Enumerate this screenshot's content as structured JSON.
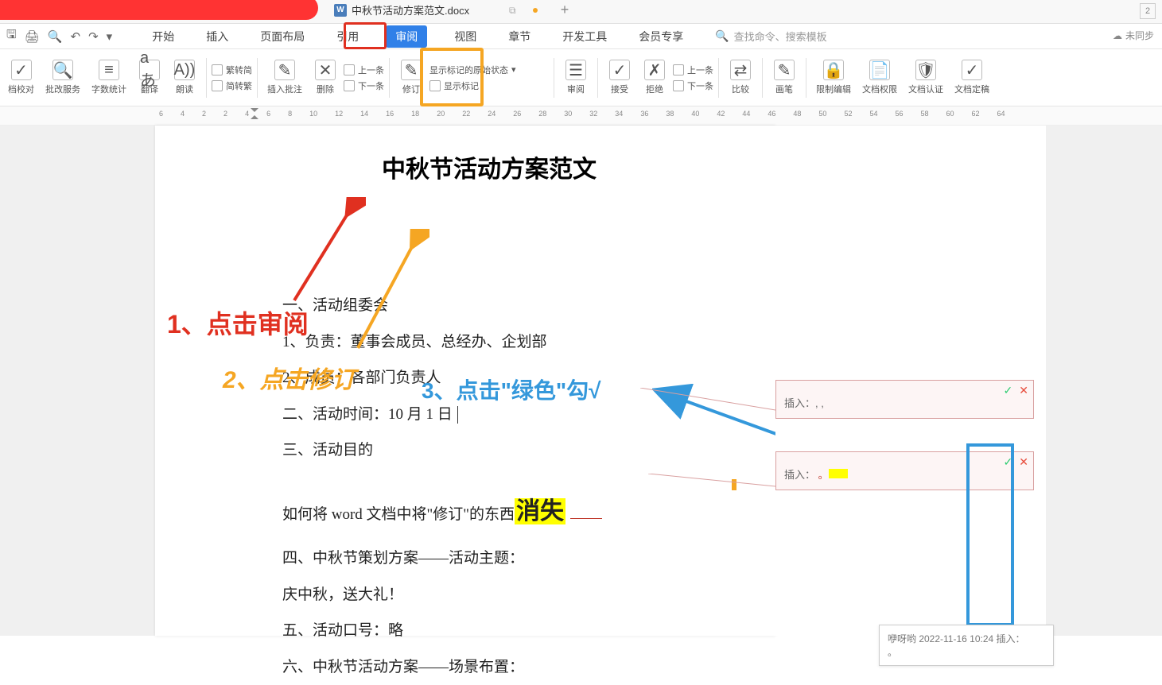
{
  "title_bar": {
    "file_name": "中秋节活动方案范文.docx",
    "file_badge": "W",
    "plus": "+",
    "right_badge": "2"
  },
  "menu": {
    "tabs": [
      "开始",
      "插入",
      "页面布局",
      "引用",
      "审阅",
      "视图",
      "章节",
      "开发工具",
      "会员专享"
    ],
    "active_index": 4,
    "search_placeholder": "查找命令、搜索模板",
    "sync": "未同步"
  },
  "ribbon": {
    "档校对": "档校对",
    "批改服务": "批改服务",
    "字数统计": "字数统计",
    "翻译": "翻译",
    "朗读": "朗读",
    "繁转简": "繁转简",
    "简转繁": "简转繁",
    "插入批注": "插入批注",
    "删除": "删除",
    "上一条": "上一条",
    "下一条": "下一条",
    "修订": "修订",
    "显示标记的原始状态": "显示标记的原始状态",
    "显示标记": "显示标记",
    "审阅": "审阅",
    "接受": "接受",
    "拒绝": "拒绝",
    "r上一条": "上一条",
    "r下一条": "下一条",
    "比较": "比较",
    "画笔": "画笔",
    "限制编辑": "限制编辑",
    "文档权限": "文档权限",
    "文档认证": "文档认证",
    "文档定稿": "文档定稿"
  },
  "annotations": {
    "step1": "1、点击审阅",
    "step2": "2、点击修订",
    "step3": "3、点击\"绿色\"勾√"
  },
  "document": {
    "title": "中秋节活动方案范文",
    "p1": "一、活动组委会",
    "p2": "1、负责：董事会成员、总经办、企划部",
    "p3": "2、成员：各部门负责人",
    "p4": "二、活动时间：10 月 1 日",
    "p5": "三、活动目的",
    "p6a": "如何将 word 文档中将\"修订\"的东西",
    "p6b": "消失",
    "p7": "四、中秋节策划方案——活动主题：",
    "p8": "庆中秋，送大礼！",
    "p9": "五、活动口号：略",
    "p10": "六、中秋节活动方案——场景布置："
  },
  "comments": {
    "c1_label": "插入：, ,",
    "c2_label": "插入：",
    "tooltip": "咿呀哟 2022-11-16 10:24 插入："
  },
  "ruler_marks": [
    "6",
    "4",
    "2",
    "2",
    "4",
    "6",
    "8",
    "10",
    "12",
    "14",
    "16",
    "18",
    "20",
    "22",
    "24",
    "26",
    "28",
    "30",
    "32",
    "34",
    "36",
    "38",
    "40",
    "42",
    "44",
    "46",
    "48",
    "50",
    "52",
    "54",
    "56",
    "58",
    "60",
    "62",
    "64"
  ]
}
